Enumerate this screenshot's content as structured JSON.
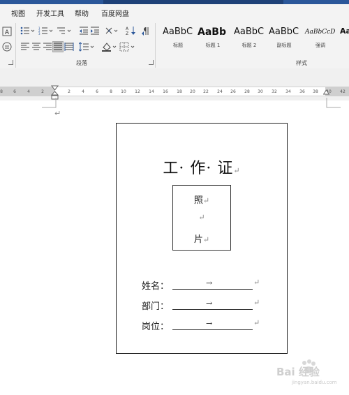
{
  "menu": [
    "视图",
    "开发工具",
    "帮助",
    "百度网盘"
  ],
  "ribbon": {
    "paragraph_group_label": "段落",
    "styles_group_label": "样式",
    "styles": [
      {
        "preview": "AaBbC",
        "label": "标题"
      },
      {
        "preview": "AaBb",
        "label": "标题 1"
      },
      {
        "preview": "AaBbC",
        "label": "标题 2"
      },
      {
        "preview": "AaBbC",
        "label": "副标题"
      },
      {
        "preview": "AaBbCcD",
        "label": "强调"
      },
      {
        "preview": "AaB",
        "label": ""
      }
    ]
  },
  "ruler": {
    "ticks": [
      "8",
      "6",
      "4",
      "2",
      "2",
      "4",
      "6",
      "8",
      "10",
      "12",
      "14",
      "16",
      "18",
      "20",
      "22",
      "24",
      "26",
      "28",
      "30",
      "32",
      "34",
      "36",
      "38",
      "40",
      "42"
    ]
  },
  "document": {
    "paragraph_mark": "↵",
    "card_title": "工· 作· 证",
    "photo_lines": [
      "照",
      "",
      "片"
    ],
    "fields": [
      {
        "label": "姓名：",
        "arrow": "→"
      },
      {
        "label": "部门：",
        "arrow": "→"
      },
      {
        "label": "岗位：",
        "arrow": "→"
      }
    ]
  },
  "watermark": {
    "text": "Bai  经验",
    "url": "jingyan.baidu.com"
  },
  "colors": {
    "title_bar": "#2b579a",
    "ribbon_bg": "#f3f3f3",
    "ruler_bg": "#f0f0f0"
  }
}
